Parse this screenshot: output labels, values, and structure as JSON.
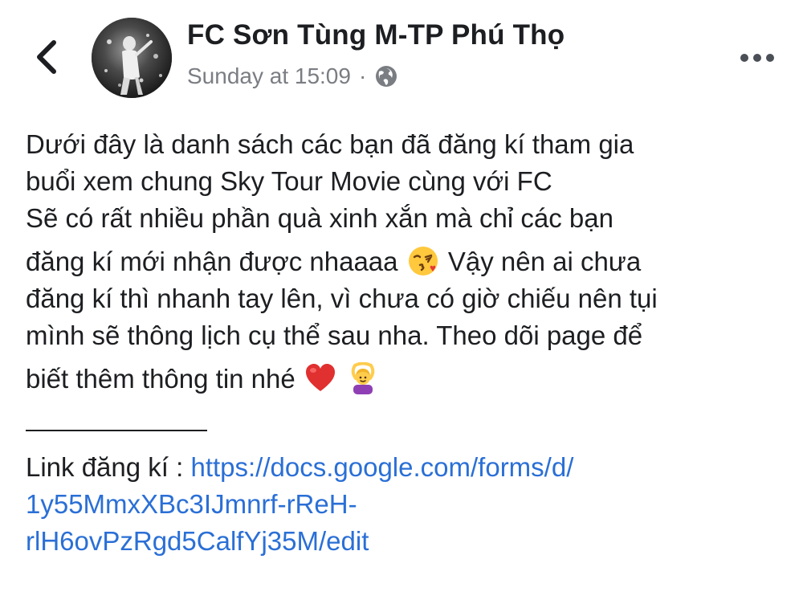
{
  "header": {
    "page_name": "FC Sơn Tùng M-TP Phú Thọ",
    "timestamp": "Sunday at 15:09",
    "separator": "·",
    "back_icon": "chevron-left-icon",
    "privacy_icon": "globe-icon",
    "more_icon": "more-horizontal-icon"
  },
  "post": {
    "lines": [
      "Dưới đây là danh sách các bạn đã đăng kí tham gia",
      "buổi xem chung Sky Tour Movie cùng với FC",
      "Sẽ có rất nhiều phần quà xinh xắn mà chỉ các bạn",
      "đăng kí mới nhận được nhaaaa",
      "Vậy nên ai chưa",
      "đăng kí thì nhanh tay lên, vì chưa có giờ chiếu nên tụi",
      "mình sẽ thông lịch cụ thể sau nha. Theo dõi page để",
      "biết thêm thông tin nhé"
    ],
    "emojis": {
      "kiss": "face-blowing-kiss-icon",
      "heart": "red-heart-icon",
      "ok_gesture": "person-gesturing-ok-icon"
    },
    "link_label": "Link đăng kí :",
    "link_lines": [
      "https://docs.google.com/forms/d/",
      "1y55MmxXBc3IJmnrf-rReH-",
      "rlH6ovPzRgd5CalfYj35M/edit"
    ]
  },
  "colors": {
    "text": "#1c1e21",
    "meta": "#7a7d82",
    "link": "#2a6fd6",
    "heart": "#e0302f"
  }
}
